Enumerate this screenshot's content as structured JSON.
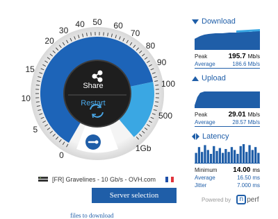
{
  "gauge": {
    "ticks": [
      "0",
      "5",
      "10",
      "15",
      "20",
      "30",
      "40",
      "50",
      "60",
      "70",
      "80",
      "90",
      "100",
      "500",
      "1Gb"
    ],
    "share_label": "Share",
    "restart_label": "Restart"
  },
  "server": {
    "name": "[FR] Gravelines - 10 Gb/s - OVH.com",
    "button_label": "Server selection"
  },
  "files_link": "files to download",
  "download": {
    "title": "Download",
    "peak_label": "Peak",
    "peak_value": "195.7",
    "peak_unit": "Mb/s",
    "avg_label": "Average",
    "avg_value": "186.6 Mb/s"
  },
  "upload": {
    "title": "Upload",
    "peak_label": "Peak",
    "peak_value": "29.01",
    "peak_unit": "Mb/s",
    "avg_label": "Average",
    "avg_value": "28.57 Mb/s"
  },
  "latency": {
    "title": "Latency",
    "min_label": "Minimum",
    "min_value": "14.00",
    "min_unit": "ms",
    "avg_label": "Average",
    "avg_value": "16.50 ms",
    "jitter_label": "Jitter",
    "jitter_value": "7.000 ms",
    "bars": [
      0.55,
      0.85,
      0.6,
      0.95,
      0.7,
      0.5,
      0.9,
      0.65,
      0.8,
      0.55,
      0.75,
      0.6,
      0.85,
      0.7,
      0.5,
      0.9,
      1.0,
      0.6,
      0.95,
      0.7,
      0.85,
      0.55
    ]
  },
  "powered_by": "Powered by",
  "brand": "perf",
  "colors": {
    "primary": "#1f5ea8",
    "gauge_dark": "#1d64b8",
    "gauge_light": "#3aa7e3",
    "center": "#1e1e1e"
  }
}
